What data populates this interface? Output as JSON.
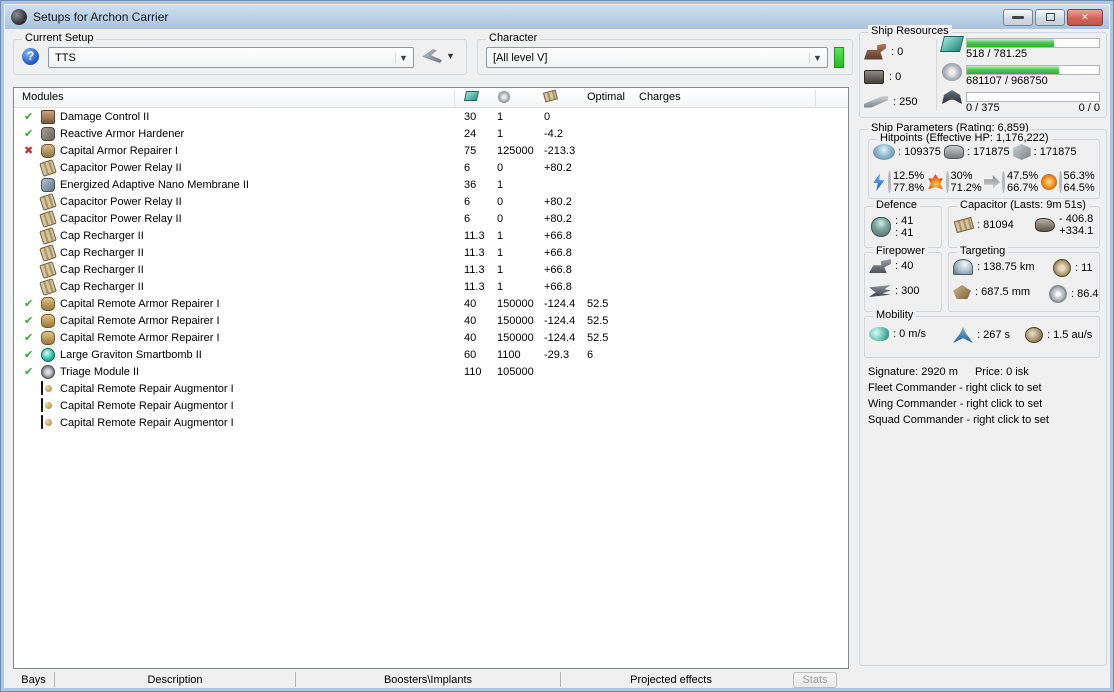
{
  "window": {
    "title": "Setups for Archon Carrier"
  },
  "toolbar": {
    "current_setup_label": "Current Setup",
    "current_setup_value": "TTS",
    "character_label": "Character",
    "character_value": "[All level V]"
  },
  "modules": {
    "header_label": "Modules",
    "optimal_label": "Optimal",
    "charges_label": "Charges",
    "rows": [
      {
        "status": "ok",
        "icon": "i-dmgctl",
        "name": "Damage Control II",
        "cpu": "30",
        "pg": "1",
        "cap": "0",
        "optimal": "",
        "charges": ""
      },
      {
        "status": "ok",
        "icon": "i-hardener",
        "name": "Reactive Armor Hardener",
        "cpu": "24",
        "pg": "1",
        "cap": "-4.2",
        "optimal": "",
        "charges": ""
      },
      {
        "status": "fail",
        "icon": "i-caprep",
        "name": "Capital Armor Repairer I",
        "cpu": "75",
        "pg": "125000",
        "cap": "-213.3",
        "optimal": "",
        "charges": ""
      },
      {
        "status": "",
        "icon": "i-caprelay",
        "name": "Capacitor Power Relay II",
        "cpu": "6",
        "pg": "0",
        "cap": "+80.2",
        "optimal": "",
        "charges": ""
      },
      {
        "status": "",
        "icon": "i-membrane",
        "name": "Energized Adaptive Nano Membrane II",
        "cpu": "36",
        "pg": "1",
        "cap": "",
        "optimal": "",
        "charges": ""
      },
      {
        "status": "",
        "icon": "i-caprelay",
        "name": "Capacitor Power Relay II",
        "cpu": "6",
        "pg": "0",
        "cap": "+80.2",
        "optimal": "",
        "charges": ""
      },
      {
        "status": "",
        "icon": "i-caprelay",
        "name": "Capacitor Power Relay II",
        "cpu": "6",
        "pg": "0",
        "cap": "+80.2",
        "optimal": "",
        "charges": ""
      },
      {
        "status": "",
        "icon": "i-recharger",
        "name": "Cap Recharger II",
        "cpu": "11.3",
        "pg": "1",
        "cap": "+66.8",
        "optimal": "",
        "charges": ""
      },
      {
        "status": "",
        "icon": "i-recharger",
        "name": "Cap Recharger II",
        "cpu": "11.3",
        "pg": "1",
        "cap": "+66.8",
        "optimal": "",
        "charges": ""
      },
      {
        "status": "",
        "icon": "i-recharger",
        "name": "Cap Recharger II",
        "cpu": "11.3",
        "pg": "1",
        "cap": "+66.8",
        "optimal": "",
        "charges": ""
      },
      {
        "status": "",
        "icon": "i-recharger",
        "name": "Cap Recharger II",
        "cpu": "11.3",
        "pg": "1",
        "cap": "+66.8",
        "optimal": "",
        "charges": ""
      },
      {
        "status": "ok",
        "icon": "i-remoterep",
        "name": "Capital Remote Armor Repairer I",
        "cpu": "40",
        "pg": "150000",
        "cap": "-124.4",
        "optimal": "52.5",
        "charges": ""
      },
      {
        "status": "ok",
        "icon": "i-remoterep",
        "name": "Capital Remote Armor Repairer I",
        "cpu": "40",
        "pg": "150000",
        "cap": "-124.4",
        "optimal": "52.5",
        "charges": ""
      },
      {
        "status": "ok",
        "icon": "i-remoterep",
        "name": "Capital Remote Armor Repairer I",
        "cpu": "40",
        "pg": "150000",
        "cap": "-124.4",
        "optimal": "52.5",
        "charges": ""
      },
      {
        "status": "ok",
        "icon": "i-smartbomb",
        "name": "Large Graviton Smartbomb II",
        "cpu": "60",
        "pg": "1100",
        "cap": "-29.3",
        "optimal": "6",
        "charges": ""
      },
      {
        "status": "ok",
        "icon": "i-triage",
        "name": "Triage Module II",
        "cpu": "110",
        "pg": "105000",
        "cap": "",
        "optimal": "",
        "charges": ""
      },
      {
        "status": "",
        "icon": "i-rig",
        "name": "Capital Remote Repair Augmentor I",
        "cpu": "",
        "pg": "",
        "cap": "",
        "optimal": "",
        "charges": ""
      },
      {
        "status": "",
        "icon": "i-rig",
        "name": "Capital Remote Repair Augmentor I",
        "cpu": "",
        "pg": "",
        "cap": "",
        "optimal": "",
        "charges": ""
      },
      {
        "status": "",
        "icon": "i-rig",
        "name": "Capital Remote Repair Augmentor I",
        "cpu": "",
        "pg": "",
        "cap": "",
        "optimal": "",
        "charges": ""
      }
    ]
  },
  "ship_resources": {
    "title": "Ship Resources",
    "turrets": ": 0",
    "launchers": ": 0",
    "calibration": ": 250",
    "cpu_text": "518 / 781.25",
    "cpu_pct": 66,
    "pg_text": "681107 / 968750",
    "pg_pct": 70,
    "drone_text": "0 / 375",
    "drone_right": "0 / 0",
    "drone_pct": 0
  },
  "ship_parameters": {
    "title": "Ship Parameters (Rating: 6,859)",
    "hitpoints": {
      "title": "Hitpoints (Effective HP: 1,176,222)",
      "shield": ": 109375",
      "armor": ": 171875",
      "hull": ": 171875",
      "resists": [
        {
          "top": "12.5%",
          "bottom": "77.8%"
        },
        {
          "top": "30%",
          "bottom": "71.2%"
        },
        {
          "top": "47.5%",
          "bottom": "66.7%"
        },
        {
          "top": "56.3%",
          "bottom": "64.5%"
        }
      ]
    },
    "defence": {
      "title": "Defence",
      "line1": ": 41",
      "line2": ": 41"
    },
    "capacitor": {
      "title": "Capacitor (Lasts: 9m 51s)",
      "amount": ": 81094",
      "drain": "- 406.8",
      "recharge": "+334.1"
    },
    "firepower": {
      "title": "Firepower",
      "dps": ": 40",
      "volley": ": 300"
    },
    "targeting": {
      "title": "Targeting",
      "range": ": 138.75 km",
      "max_targets": ": 11",
      "scan_res": ": 687.5 mm",
      "sensor": ": 86.4"
    },
    "mobility": {
      "title": "Mobility",
      "speed": ": 0 m/s",
      "align": ": 267 s",
      "warp": ": 1.5 au/s"
    },
    "signature": "Signature: 2920 m",
    "price": "Price: 0 isk",
    "fleet": "Fleet Commander - right click to set",
    "wing": "Wing Commander - right click to set",
    "squad": "Squad Commander - right click to set"
  },
  "bottom_tabs": {
    "bays": "Bays",
    "description": "Description",
    "boosters": "Boosters\\Implants",
    "projected": "Projected effects",
    "stats_button": "Stats"
  }
}
